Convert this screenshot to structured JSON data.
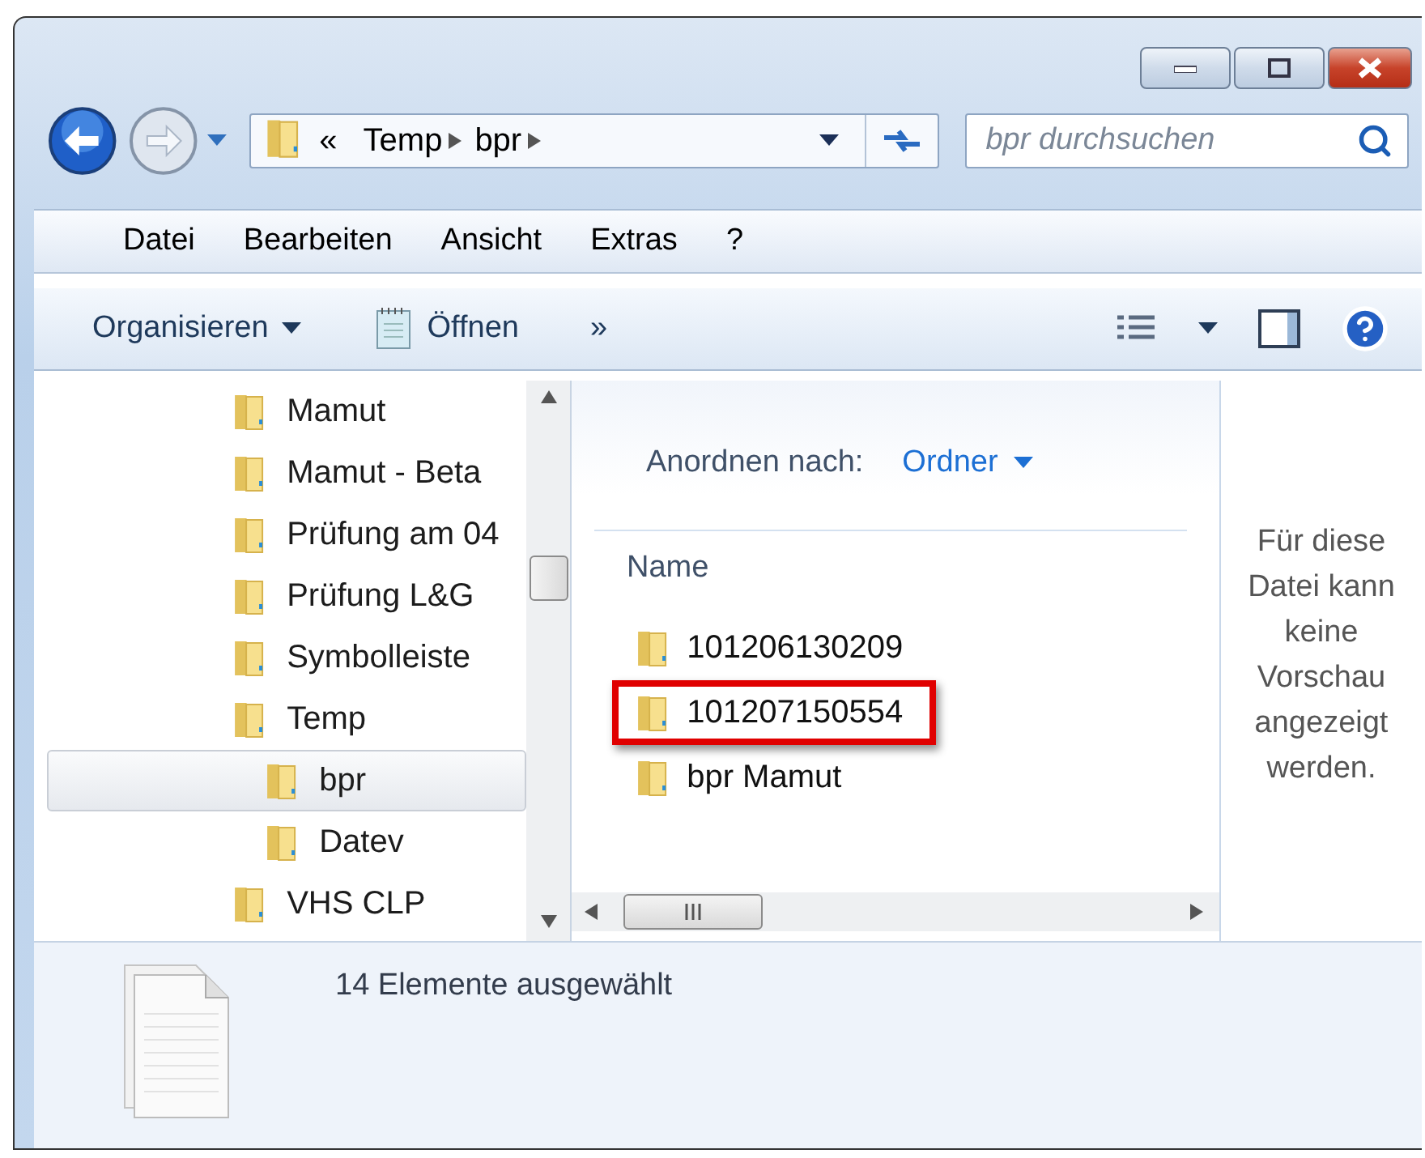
{
  "address": {
    "overflow": "«",
    "path": [
      "Temp",
      "bpr"
    ]
  },
  "search": {
    "placeholder": "bpr durchsuchen"
  },
  "menu": [
    "Datei",
    "Bearbeiten",
    "Ansicht",
    "Extras",
    "?"
  ],
  "toolbar": {
    "items": [
      {
        "kind": "dropdown",
        "label": "Organisieren"
      },
      {
        "kind": "open",
        "label": "Öffnen"
      }
    ],
    "overflow": "»"
  },
  "tree": [
    {
      "label": "Mamut",
      "selected": false
    },
    {
      "label": "Mamut - Beta",
      "selected": false
    },
    {
      "label": "Prüfung am 04",
      "selected": false
    },
    {
      "label": "Prüfung L&G",
      "selected": false
    },
    {
      "label": "Symbolleiste",
      "selected": false
    },
    {
      "label": "Temp",
      "selected": false,
      "children": [
        {
          "label": "bpr",
          "selected": true
        },
        {
          "label": "Datev",
          "selected": false
        }
      ]
    },
    {
      "label": "VHS CLP",
      "selected": false
    }
  ],
  "arrange": {
    "label": "Anordnen nach:",
    "value": "Ordner"
  },
  "files": {
    "column": "Name",
    "items": [
      {
        "name": "101206130209",
        "highlighted": false
      },
      {
        "name": "101207150554",
        "highlighted": true
      },
      {
        "name": "bpr Mamut",
        "highlighted": false
      }
    ]
  },
  "preview": {
    "message": "Für diese Datei kann keine Vorschau angezeigt werden."
  },
  "details": {
    "text": "14 Elemente ausgewählt"
  }
}
